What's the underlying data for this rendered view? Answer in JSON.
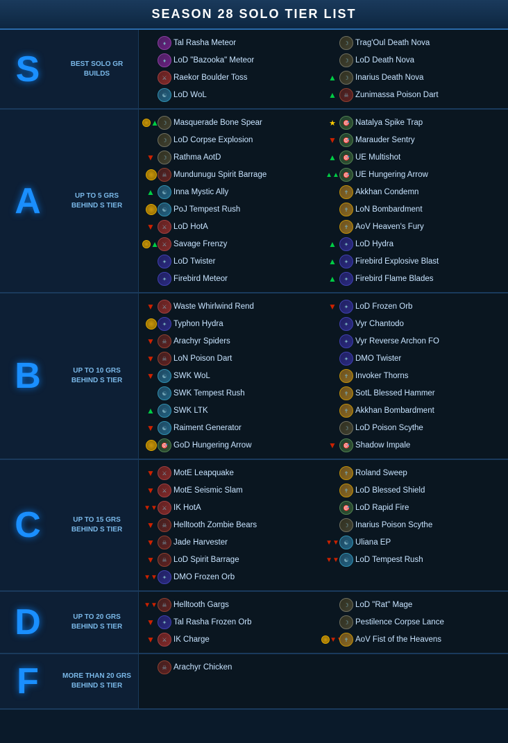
{
  "header": {
    "title": "SEASON 28 SOLO TIER LIST"
  },
  "tiers": [
    {
      "id": "S",
      "letter": "S",
      "description": "BEST SOLO\nGR BUILDS",
      "left_builds": [
        {
          "name": "Tal Rasha Meteor",
          "avatar": "witch",
          "indicator": ""
        },
        {
          "name": "LoD \"Bazooka\" Meteor",
          "avatar": "witch",
          "indicator": ""
        },
        {
          "name": "Raekor Boulder Toss",
          "avatar": "barb",
          "indicator": ""
        },
        {
          "name": "LoD WoL",
          "avatar": "monk",
          "indicator": ""
        }
      ],
      "right_builds": [
        {
          "name": "Trag'Oul Death Nova",
          "avatar": "necro",
          "indicator": ""
        },
        {
          "name": "LoD Death Nova",
          "avatar": "necro",
          "indicator": ""
        },
        {
          "name": "Inarius Death Nova",
          "avatar": "necro",
          "indicator": "up"
        },
        {
          "name": "Zunimassa Poison Dart",
          "avatar": "wd",
          "indicator": "up"
        }
      ]
    },
    {
      "id": "A",
      "letter": "A",
      "description": "UP TO 5 GRS\nBEHIND S TIER",
      "left_builds": [
        {
          "name": "Masquerade Bone Spear",
          "avatar": "necro",
          "indicator": "gold-up"
        },
        {
          "name": "LoD Corpse Explosion",
          "avatar": "necro",
          "indicator": ""
        },
        {
          "name": "Rathma AotD",
          "avatar": "necro",
          "indicator": "down"
        },
        {
          "name": "Mundunugu Spirit Barrage",
          "avatar": "wd",
          "indicator": "gold"
        },
        {
          "name": "Inna Mystic Ally",
          "avatar": "monk",
          "indicator": "up"
        },
        {
          "name": "PoJ Tempest Rush",
          "avatar": "monk",
          "indicator": "gold"
        },
        {
          "name": "LoD HotA",
          "avatar": "barb",
          "indicator": "down"
        },
        {
          "name": "Savage Frenzy",
          "avatar": "barb",
          "indicator": "gold-up"
        },
        {
          "name": "LoD Twister",
          "avatar": "wizard",
          "indicator": ""
        },
        {
          "name": "Firebird Meteor",
          "avatar": "wizard",
          "indicator": ""
        }
      ],
      "right_builds": [
        {
          "name": "Natalya Spike Trap",
          "avatar": "dh",
          "indicator": "star"
        },
        {
          "name": "Marauder Sentry",
          "avatar": "dh",
          "indicator": "down"
        },
        {
          "name": "UE Multishot",
          "avatar": "dh",
          "indicator": "up"
        },
        {
          "name": "UE Hungering Arrow",
          "avatar": "dh",
          "indicator": "double-up"
        },
        {
          "name": "Akkhan Condemn",
          "avatar": "crusader",
          "indicator": ""
        },
        {
          "name": "LoN Bombardment",
          "avatar": "crusader",
          "indicator": ""
        },
        {
          "name": "AoV Heaven's Fury",
          "avatar": "crusader",
          "indicator": ""
        },
        {
          "name": "LoD Hydra",
          "avatar": "wizard",
          "indicator": "up"
        },
        {
          "name": "Firebird Explosive Blast",
          "avatar": "wizard",
          "indicator": "up"
        },
        {
          "name": "Firebird Flame Blades",
          "avatar": "wizard",
          "indicator": "up"
        }
      ]
    },
    {
      "id": "B",
      "letter": "B",
      "description": "UP TO 10 GRS\nBEHIND S TIER",
      "left_builds": [
        {
          "name": "Waste Whirlwind Rend",
          "avatar": "barb",
          "indicator": "down"
        },
        {
          "name": "Typhon Hydra",
          "avatar": "wizard",
          "indicator": "gold"
        },
        {
          "name": "Arachyr Spiders",
          "avatar": "wd",
          "indicator": "down"
        },
        {
          "name": "LoN Poison Dart",
          "avatar": "wd",
          "indicator": "down"
        },
        {
          "name": "SWK WoL",
          "avatar": "monk",
          "indicator": "down"
        },
        {
          "name": "SWK Tempest Rush",
          "avatar": "monk",
          "indicator": ""
        },
        {
          "name": "SWK LTK",
          "avatar": "monk",
          "indicator": "up"
        },
        {
          "name": "Raiment Generator",
          "avatar": "monk",
          "indicator": "down"
        },
        {
          "name": "GoD Hungering Arrow",
          "avatar": "dh",
          "indicator": "gold"
        }
      ],
      "right_builds": [
        {
          "name": "LoD Frozen Orb",
          "avatar": "wizard",
          "indicator": "down"
        },
        {
          "name": "Vyr Chantodo",
          "avatar": "wizard",
          "indicator": ""
        },
        {
          "name": "Vyr Reverse Archon FO",
          "avatar": "wizard",
          "indicator": ""
        },
        {
          "name": "DMO Twister",
          "avatar": "wizard",
          "indicator": ""
        },
        {
          "name": "Invoker Thorns",
          "avatar": "crusader",
          "indicator": ""
        },
        {
          "name": "SotL Blessed Hammer",
          "avatar": "crusader",
          "indicator": ""
        },
        {
          "name": "Akkhan Bombardment",
          "avatar": "crusader",
          "indicator": ""
        },
        {
          "name": "LoD Poison Scythe",
          "avatar": "necro",
          "indicator": ""
        },
        {
          "name": "Shadow Impale",
          "avatar": "dh",
          "indicator": "down"
        }
      ]
    },
    {
      "id": "C",
      "letter": "C",
      "description": "UP TO 15 GRS\nBEHIND S TIER",
      "left_builds": [
        {
          "name": "MotE Leapquake",
          "avatar": "barb",
          "indicator": "down"
        },
        {
          "name": "MotE Seismic Slam",
          "avatar": "barb",
          "indicator": "down"
        },
        {
          "name": "IK HotA",
          "avatar": "barb",
          "indicator": "double-down"
        },
        {
          "name": "Helltooth Zombie Bears",
          "avatar": "wd",
          "indicator": "down"
        },
        {
          "name": "Jade Harvester",
          "avatar": "wd",
          "indicator": "down"
        },
        {
          "name": "LoD Spirit Barrage",
          "avatar": "wd",
          "indicator": "down"
        },
        {
          "name": "DMO Frozen Orb",
          "avatar": "wizard",
          "indicator": "double-down"
        }
      ],
      "right_builds": [
        {
          "name": "Roland Sweep",
          "avatar": "crusader",
          "indicator": ""
        },
        {
          "name": "LoD Blessed Shield",
          "avatar": "crusader",
          "indicator": ""
        },
        {
          "name": "LoD Rapid Fire",
          "avatar": "dh",
          "indicator": ""
        },
        {
          "name": "Inarius Poison Scythe",
          "avatar": "necro",
          "indicator": ""
        },
        {
          "name": "Uliana EP",
          "avatar": "monk",
          "indicator": "double-down"
        },
        {
          "name": "LoD Tempest Rush",
          "avatar": "monk",
          "indicator": "double-down"
        }
      ]
    },
    {
      "id": "D",
      "letter": "D",
      "description": "UP TO 20 GRS\nBEHIND S TIER",
      "left_builds": [
        {
          "name": "Helltooth Gargs",
          "avatar": "wd",
          "indicator": "double-down"
        },
        {
          "name": "Tal Rasha Frozen Orb",
          "avatar": "wizard",
          "indicator": "down"
        },
        {
          "name": "IK Charge",
          "avatar": "barb",
          "indicator": "down"
        }
      ],
      "right_builds": [
        {
          "name": "LoD \"Rat\" Mage",
          "avatar": "necro",
          "indicator": ""
        },
        {
          "name": "Pestilence Corpse Lance",
          "avatar": "necro",
          "indicator": ""
        },
        {
          "name": "AoV Fist of the Heavens",
          "avatar": "crusader",
          "indicator": "gold-double-down"
        }
      ]
    },
    {
      "id": "F",
      "letter": "F",
      "description": "MORE THAN 20 GRS\nBEHIND S TIER",
      "left_builds": [
        {
          "name": "Arachyr Chicken",
          "avatar": "wd",
          "indicator": ""
        }
      ],
      "right_builds": []
    }
  ]
}
